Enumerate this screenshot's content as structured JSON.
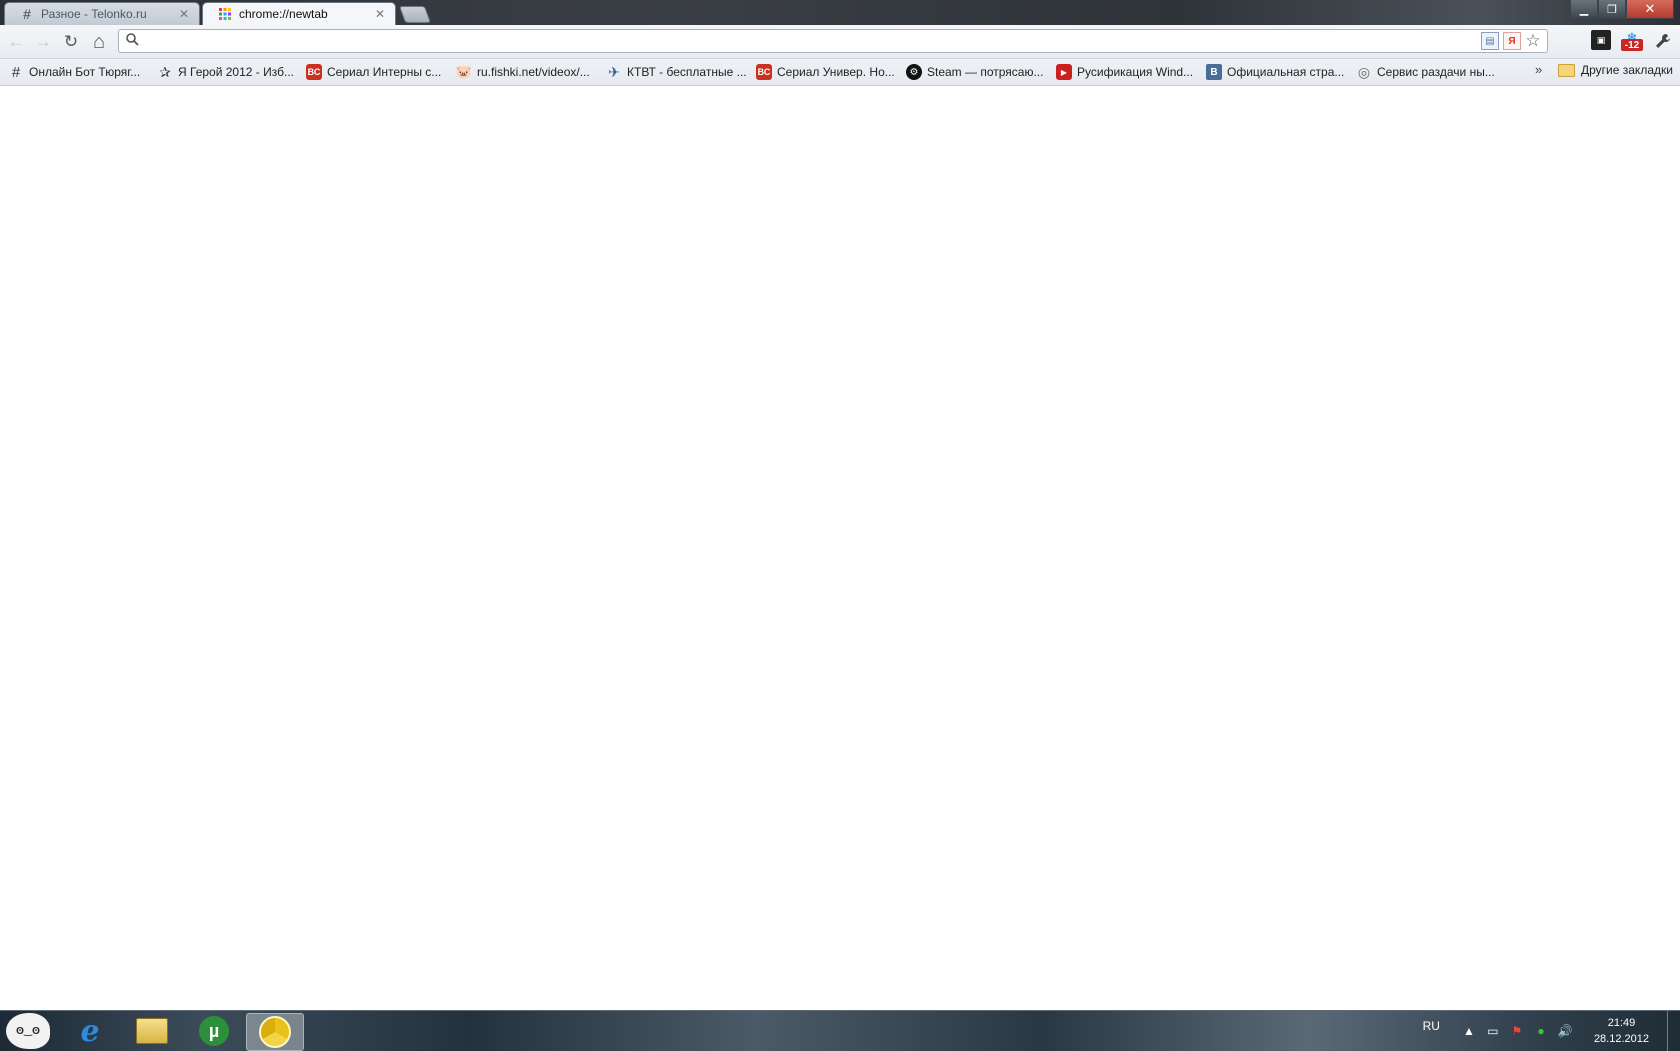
{
  "window": {
    "tabs": [
      {
        "title": "Разное - Telonko.ru",
        "favicon": "hash-icon",
        "active": false
      },
      {
        "title": "chrome://newtab",
        "favicon": "apps-grid-icon",
        "active": true
      }
    ],
    "controls": {
      "minimize": "▁",
      "maximize": "❐",
      "close": "✕"
    }
  },
  "toolbar": {
    "back_icon": "←",
    "forward_icon": "→",
    "reload_icon": "↻",
    "home_icon": "⌂",
    "omnibox": {
      "value": "",
      "placeholder": "",
      "search_icon": "🔍"
    },
    "omnibox_ya_icon": "Я",
    "star_icon": "☆",
    "wrench_icon": "🔧",
    "temp_badge": "-12"
  },
  "bookmarks": {
    "items": [
      {
        "label": "Онлайн Бот Тюряг...",
        "icon": "hash-icon"
      },
      {
        "label": "Я Герой 2012 - Изб...",
        "icon": "star-icon"
      },
      {
        "label": "Сериал Интерны с...",
        "icon": "vc-icon"
      },
      {
        "label": "ru.fishki.net/videox/...",
        "icon": "pig-icon"
      },
      {
        "label": "КТВТ - бесплатные ...",
        "icon": "ktvt-icon"
      },
      {
        "label": "Сериал Универ. Но...",
        "icon": "vc-icon"
      },
      {
        "label": "Steam — потрясаю...",
        "icon": "steam-icon"
      },
      {
        "label": "Русификация Wind...",
        "icon": "youtube-icon"
      },
      {
        "label": "Официальная стра...",
        "icon": "vk-icon"
      },
      {
        "label": "Сервис раздачи ны...",
        "icon": "globe-icon"
      }
    ],
    "overflow": "»",
    "other": "Другие закладки"
  },
  "taskbar": {
    "language": "RU",
    "time": "21:49",
    "date": "28.12.2012",
    "apps": [
      "troll-face-icon",
      "internet-explorer-icon",
      "explorer-icon",
      "utorrent-icon",
      "chrome-icon"
    ]
  }
}
